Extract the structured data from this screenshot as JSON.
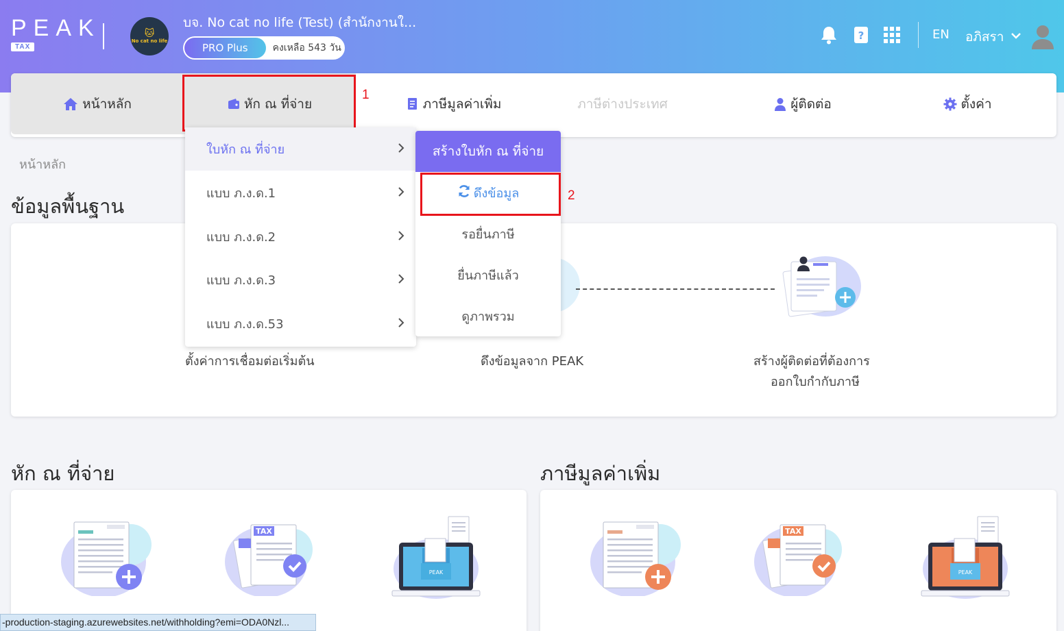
{
  "brand": {
    "logo_text": "PEAK",
    "logo_sub": "TAX"
  },
  "company": {
    "logo_text": "No cat no life",
    "name": "บจ. No cat no life (Test) (สำนักงานใ...",
    "plan": "PRO Plus",
    "days_left": "คงเหลือ 543 วัน"
  },
  "header": {
    "icons": [
      "bell-icon",
      "help-book-icon",
      "apps-grid-icon"
    ],
    "lang": "EN",
    "user_name": "อภิสรา"
  },
  "nav": {
    "items": [
      {
        "label": "หน้าหลัก",
        "icon": "home-icon"
      },
      {
        "label": "หัก ณ ที่จ่าย",
        "icon": "wallet-icon"
      },
      {
        "label": "ภาษีมูลค่าเพิ่ม",
        "icon": "document-icon"
      },
      {
        "label": "ภาษีต่างประเทศ",
        "icon": ""
      },
      {
        "label": "ผู้ติดต่อ",
        "icon": "person-icon"
      },
      {
        "label": "ตั้งค่า",
        "icon": "gear-icon"
      }
    ]
  },
  "annotations": {
    "step1": "1",
    "step2": "2"
  },
  "dropdown": {
    "items": [
      {
        "label": "ใบหัก ณ ที่จ่าย"
      },
      {
        "label": "แบบ ภ.ง.ด.1"
      },
      {
        "label": "แบบ ภ.ง.ด.2"
      },
      {
        "label": "แบบ ภ.ง.ด.3"
      },
      {
        "label": "แบบ ภ.ง.ด.53"
      }
    ]
  },
  "submenu": {
    "header": "สร้างใบหัก ณ ที่จ่าย",
    "items": [
      {
        "label": "ดึงข้อมูล",
        "icon": "sync-icon"
      },
      {
        "label": "รอยื่นภาษี"
      },
      {
        "label": "ยื่นภาษีแล้ว"
      },
      {
        "label": "ดูภาพรวม"
      }
    ]
  },
  "main": {
    "breadcrumb": "หน้าหลัก",
    "basic_title": "ข้อมูลพื้นฐาน",
    "basic_steps": [
      {
        "label": "ตั้งค่าการเชื่อมต่อเริ่มต้น"
      },
      {
        "label": "ดึงข้อมูลจาก PEAK"
      },
      {
        "label_line1": "สร้างผู้ติดต่อที่ต้องการ",
        "label_line2": "ออกใบกำกับภาษี"
      }
    ],
    "wht_title": "หัก ณ ที่จ่าย",
    "vat_title": "ภาษีมูลค่าเพิ่ม"
  },
  "status_url": "-production-staging.azurewebsites.net/withholding?emi=ODA0Nzl..."
}
